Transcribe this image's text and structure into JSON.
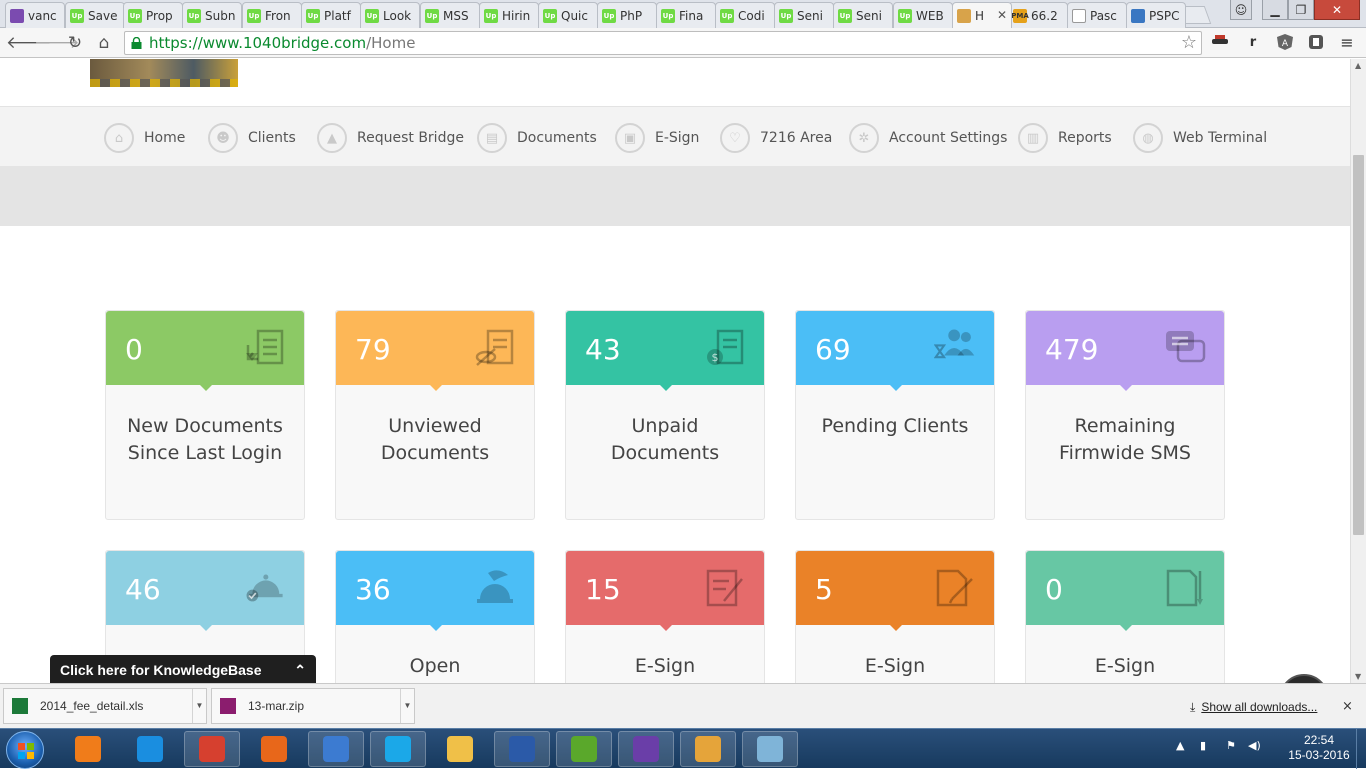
{
  "browser": {
    "tabs": [
      {
        "label": "vanc",
        "fav": "gm",
        "favtext": ""
      },
      {
        "label": "Save",
        "fav": "up",
        "favtext": "Up"
      },
      {
        "label": "Prop",
        "fav": "up",
        "favtext": "Up"
      },
      {
        "label": "Subn",
        "fav": "up",
        "favtext": "Up"
      },
      {
        "label": "Fron",
        "fav": "up",
        "favtext": "Up"
      },
      {
        "label": "Platf",
        "fav": "up",
        "favtext": "Up"
      },
      {
        "label": "Look",
        "fav": "up",
        "favtext": "Up"
      },
      {
        "label": "MSS",
        "fav": "up",
        "favtext": "Up"
      },
      {
        "label": "Hirin",
        "fav": "up",
        "favtext": "Up"
      },
      {
        "label": "Quic",
        "fav": "up",
        "favtext": "Up"
      },
      {
        "label": "PhP",
        "fav": "up",
        "favtext": "Up"
      },
      {
        "label": "Fina",
        "fav": "up",
        "favtext": "Up"
      },
      {
        "label": "Codi",
        "fav": "up",
        "favtext": "Up"
      },
      {
        "label": "Seni",
        "fav": "up",
        "favtext": "Up"
      },
      {
        "label": "Seni",
        "fav": "up",
        "favtext": "Up"
      },
      {
        "label": "WEB",
        "fav": "up",
        "favtext": "Up"
      },
      {
        "label": "H",
        "fav": "bz",
        "favtext": "",
        "active": true
      },
      {
        "label": "66.2",
        "fav": "pm",
        "favtext": "PMA"
      },
      {
        "label": "Pasc",
        "fav": "doc",
        "favtext": ""
      },
      {
        "label": "PSPC",
        "fav": "pspc",
        "favtext": ""
      }
    ],
    "url": {
      "secure": "https://www.1040bridge.com",
      "rest": "/Home"
    },
    "extensions": [
      "r"
    ]
  },
  "nav": {
    "items": [
      {
        "label": "Home",
        "icon": "home-icon",
        "glyph": "⌂"
      },
      {
        "label": "Clients",
        "icon": "clients-icon",
        "glyph": "☻"
      },
      {
        "label": "Request Bridge",
        "icon": "request-bridge-icon",
        "glyph": "▲"
      },
      {
        "label": "Documents",
        "icon": "documents-icon",
        "glyph": "▤"
      },
      {
        "label": "E-Sign",
        "icon": "esign-icon",
        "glyph": "▣"
      },
      {
        "label": "7216 Area",
        "icon": "7216-area-icon",
        "glyph": "♡"
      },
      {
        "label": "Account Settings",
        "icon": "gear-icon",
        "glyph": "✲"
      },
      {
        "label": "Reports",
        "icon": "reports-icon",
        "glyph": "▥"
      },
      {
        "label": "Web Terminal",
        "icon": "globe-icon",
        "glyph": "◍"
      }
    ]
  },
  "cards": [
    {
      "value": "0",
      "label": "New Documents Since Last Login",
      "color": "#8cc965",
      "icon": "document-download-icon"
    },
    {
      "value": "79",
      "label": "Unviewed Documents",
      "color": "#fdb757",
      "icon": "document-unviewed-icon"
    },
    {
      "value": "43",
      "label": "Unpaid Documents",
      "color": "#34c3a3",
      "icon": "document-unpaid-icon"
    },
    {
      "value": "69",
      "label": "Pending Clients",
      "color": "#4bbef6",
      "icon": "pending-clients-icon"
    },
    {
      "value": "479",
      "label": "Remaining Firmwide SMS",
      "color": "#b99ef0",
      "icon": "sms-bubbles-icon"
    },
    {
      "value": "46",
      "label": "",
      "color": "#8ed0e2",
      "icon": "service-bell-check-icon"
    },
    {
      "value": "36",
      "label": "Open",
      "color": "#4bbef6",
      "icon": "service-bell-icon"
    },
    {
      "value": "15",
      "label": "E-Sign",
      "color": "#e56b6b",
      "icon": "esign-pen-icon"
    },
    {
      "value": "5",
      "label": "E-Sign",
      "color": "#ea8228",
      "icon": "esign-pencil-icon"
    },
    {
      "value": "0",
      "label": "E-Sign",
      "color": "#67c7a4",
      "icon": "esign-document-icon"
    }
  ],
  "help": {
    "label": "?"
  },
  "knowledgebase": {
    "label": "Click here for KnowledgeBase"
  },
  "downloads": {
    "items": [
      {
        "name": "2014_fee_detail.xls",
        "type": "excel-file-icon",
        "color": "#1d7a3a"
      },
      {
        "name": "13-mar.zip",
        "type": "zip-file-icon",
        "color": "#8b1d6e"
      }
    ],
    "show_all": "Show all downloads...",
    "close": "×"
  },
  "taskbar": {
    "apps": [
      {
        "name": "media-player-icon",
        "color": "#f07c1a",
        "open": false
      },
      {
        "name": "internet-explorer-icon",
        "color": "#1a8ee0",
        "open": false
      },
      {
        "name": "chrome-icon",
        "color": "#d6402f",
        "open": true
      },
      {
        "name": "firefox-icon",
        "color": "#e8671a",
        "open": false
      },
      {
        "name": "folder-app-icon",
        "color": "#3c7bd1",
        "open": true
      },
      {
        "name": "skype-icon",
        "color": "#1ba8e8",
        "open": true
      },
      {
        "name": "file-explorer-icon",
        "color": "#f0c048",
        "open": false
      },
      {
        "name": "word-icon",
        "color": "#2b5aa8",
        "open": true
      },
      {
        "name": "spreadsheet-icon",
        "color": "#5aa82b",
        "open": true
      },
      {
        "name": "visual-studio-icon",
        "color": "#6a3ea8",
        "open": true
      },
      {
        "name": "remote-app-icon",
        "color": "#e5a43a",
        "open": true
      },
      {
        "name": "notepad-icon",
        "color": "#7fb4d8",
        "open": true
      }
    ],
    "time": "22:54",
    "date": "15-03-2016",
    "tray_arrow": "▲"
  }
}
